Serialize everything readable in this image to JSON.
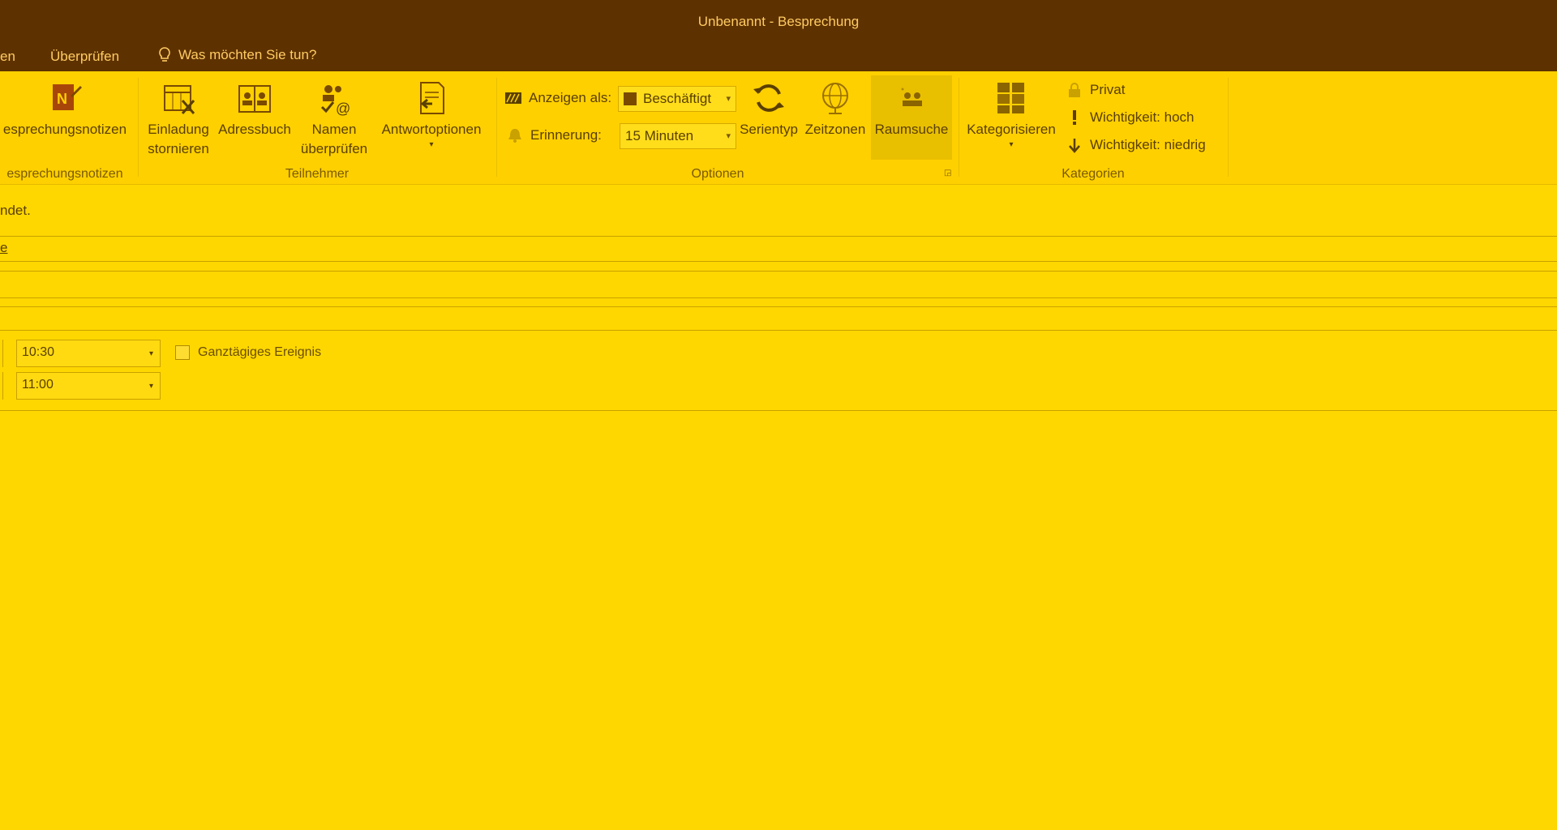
{
  "window": {
    "title": "Unbenannt - Besprechung"
  },
  "menu": {
    "items": [
      "en",
      "Überprüfen"
    ],
    "tell_me": "Was möchten Sie tun?"
  },
  "ribbon": {
    "groups": {
      "notes": {
        "label": "esprechungsnotizen",
        "button": "esprechungsnotizen"
      },
      "attendees": {
        "label": "Teilnehmer",
        "cancel_line1": "Einladung",
        "cancel_line2": "stornieren",
        "address_book": "Adressbuch",
        "check_names_line1": "Namen",
        "check_names_line2": "überprüfen",
        "response_options": "Antwortoptionen"
      },
      "options": {
        "label": "Optionen",
        "show_as_label": "Anzeigen als:",
        "show_as_value": "Beschäftigt",
        "reminder_label": "Erinnerung:",
        "reminder_value": "15 Minuten",
        "recurrence": "Serientyp",
        "time_zones": "Zeitzonen",
        "room_finder": "Raumsuche"
      },
      "tags": {
        "label": "Kategorien",
        "categorize": "Kategorisieren",
        "private": "Privat",
        "importance_high": "Wichtigkeit: hoch",
        "importance_low": "Wichtigkeit: niedrig"
      }
    },
    "colors": {
      "titlebar": "#5E3200",
      "ribbon": "#FFD000",
      "body": "#FFD700"
    }
  },
  "form": {
    "info_text": "ndet.",
    "field_fragment": "e",
    "start_time": "10:30",
    "end_time": "11:00",
    "all_day_label": "Ganztägiges Ereignis",
    "all_day_checked": false
  }
}
